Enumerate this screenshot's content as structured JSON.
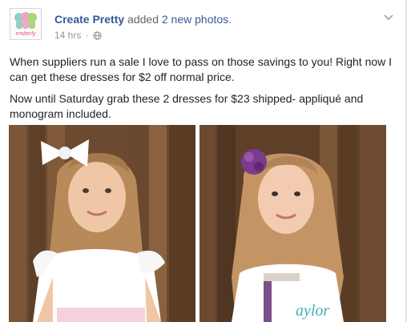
{
  "post": {
    "page_name": "Create Pretty",
    "action_text": "added",
    "photo_count_text": "2 new photos",
    "period": ".",
    "timestamp": "14 hrs",
    "separator": "·",
    "privacy_icon": "globe-icon",
    "menu_icon": "chevron-down-icon",
    "avatar_logo_text": "emberly",
    "paragraphs": [
      "When suppliers run a sale I love to pass on those savings to you! Right now I can get these dresses for $2 off normal price.",
      "Now until Saturday grab these 2 dresses for $23 shipped- appliqué and monogram included."
    ],
    "photos": [
      {
        "alt": "Girl in white dress with large white hair bow against wooden fence"
      },
      {
        "alt": "Girl with purple flower headband in appliqué monogram dress against wooden fence"
      }
    ],
    "photo2_monogram": "aylor"
  },
  "colors": {
    "link": "#365899",
    "muted": "#90949c",
    "body_text": "#1d2129",
    "background": "#e9ebee"
  }
}
